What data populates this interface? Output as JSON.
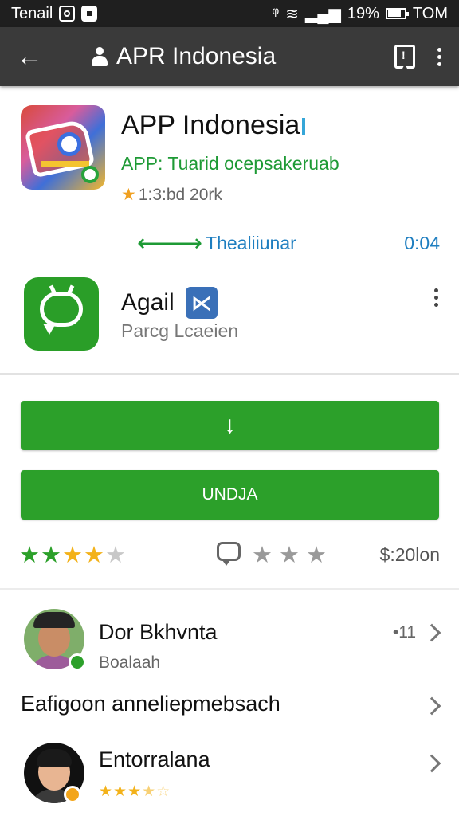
{
  "status_bar": {
    "carrier": "Tenail",
    "battery": "19%",
    "time": "TOM"
  },
  "app_bar": {
    "title": "APR Indonesia",
    "bookmark_glyph": "!"
  },
  "featured_app": {
    "name": "APP Indonesia",
    "developer": "APP: Tuarid ocepsakeruab",
    "meta": "1:3:bd 20rk",
    "link_label": "Thealiiunar",
    "duration": "0:04"
  },
  "second_app": {
    "name": "Agail",
    "badge_glyph": "⋉",
    "subtitle": "Parcg Lcaeien"
  },
  "buttons": {
    "download_glyph": "↓",
    "install_label": "UNDJA"
  },
  "rating": {
    "stars": 3.5,
    "gray_stars": 3,
    "price": "$:20lon"
  },
  "reviews": [
    {
      "name": "Dor Bkhvnta",
      "subtitle": "Boalaah",
      "count": "•11"
    },
    {
      "text": "Eafigoon anneliepmebsach"
    },
    {
      "name": "Entorralana",
      "rating": 3.5
    }
  ],
  "colors": {
    "accent_green": "#2ca02a",
    "link_blue": "#1e7ec0",
    "app_bar": "#3a3a3a",
    "star_gold": "#f3b21a"
  },
  "icons": [
    "back-arrow-icon",
    "person-icon",
    "bookmark-icon",
    "more-vert-icon",
    "download-arrow-icon",
    "comment-icon",
    "star-icon",
    "chevron-right-icon"
  ]
}
